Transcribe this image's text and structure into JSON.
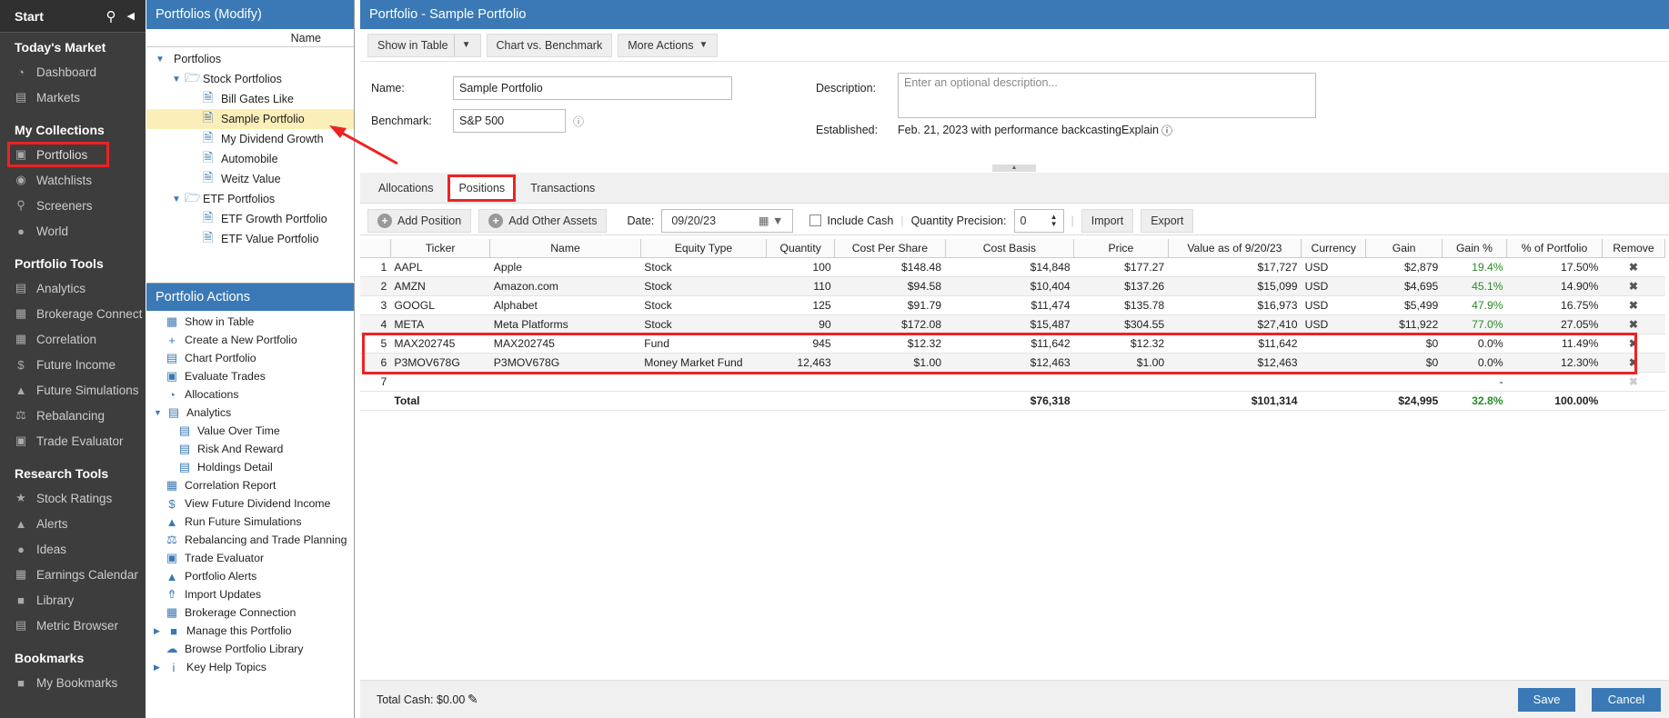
{
  "sidebar": {
    "start": "Start",
    "sections": [
      {
        "title": "Today's Market",
        "items": [
          {
            "label": "Dashboard",
            "icon": "dashboard-icon"
          },
          {
            "label": "Markets",
            "icon": "chart-icon"
          }
        ]
      },
      {
        "title": "My Collections",
        "items": [
          {
            "label": "Portfolios",
            "icon": "briefcase-icon"
          },
          {
            "label": "Watchlists",
            "icon": "binoculars-icon"
          },
          {
            "label": "Screeners",
            "icon": "search-icon"
          },
          {
            "label": "World",
            "icon": "globe-icon"
          }
        ]
      },
      {
        "title": "Portfolio Tools",
        "items": [
          {
            "label": "Analytics",
            "icon": "chart-icon"
          },
          {
            "label": "Brokerage Connect",
            "icon": "bank-icon"
          },
          {
            "label": "Correlation",
            "icon": "grid-icon"
          },
          {
            "label": "Future Income",
            "icon": "dollar-icon"
          },
          {
            "label": "Future Simulations",
            "icon": "flask-icon"
          },
          {
            "label": "Rebalancing",
            "icon": "scale-icon"
          },
          {
            "label": "Trade Evaluator",
            "icon": "briefcase-icon"
          }
        ]
      },
      {
        "title": "Research Tools",
        "items": [
          {
            "label": "Stock Ratings",
            "icon": "star-icon"
          },
          {
            "label": "Alerts",
            "icon": "bell-icon"
          },
          {
            "label": "Ideas",
            "icon": "bulb-icon"
          },
          {
            "label": "Earnings Calendar",
            "icon": "calendar-icon"
          },
          {
            "label": "Library",
            "icon": "book-icon"
          },
          {
            "label": "Metric Browser",
            "icon": "window-icon"
          }
        ]
      },
      {
        "title": "Bookmarks",
        "items": [
          {
            "label": "My Bookmarks",
            "icon": "bookmark-icon"
          }
        ]
      }
    ]
  },
  "tree": {
    "header": "Portfolios (Modify)",
    "column": "Name",
    "root": "Portfolios",
    "stock_folder": "Stock Portfolios",
    "stock_items": [
      "Bill Gates Like",
      "Sample Portfolio",
      "My Dividend Growth",
      "Automobile",
      "Weitz Value"
    ],
    "etf_folder": "ETF Portfolios",
    "etf_items": [
      "ETF Growth Portfolio",
      "ETF Value Portfolio"
    ]
  },
  "actions": {
    "header": "Portfolio Actions",
    "items": [
      "Show in Table",
      "Create a New Portfolio",
      "Chart Portfolio",
      "Evaluate Trades",
      "Allocations",
      "Analytics",
      "Value Over Time",
      "Risk And Reward",
      "Holdings Detail",
      "Correlation Report",
      "View Future Dividend Income",
      "Run Future Simulations",
      "Rebalancing and Trade Planning",
      "Trade Evaluator",
      "Portfolio Alerts",
      "Import Updates",
      "Brokerage Connection",
      "Manage this Portfolio",
      "Browse Portfolio Library",
      "Key Help Topics"
    ]
  },
  "main": {
    "title": "Portfolio - Sample Portfolio",
    "toolbar": {
      "show_table": "Show in Table",
      "chart_bench": "Chart vs. Benchmark",
      "more": "More Actions"
    },
    "form": {
      "name_label": "Name:",
      "name_value": "Sample Portfolio",
      "bench_label": "Benchmark:",
      "bench_value": "S&P 500",
      "desc_label": "Description:",
      "desc_placeholder": "Enter an optional description...",
      "est_label": "Established:",
      "est_value": "Feb. 21, 2023 with performance backcasting.",
      "explain": "Explain"
    },
    "tabs": [
      "Allocations",
      "Positions",
      "Transactions"
    ],
    "ptoolbar": {
      "add_position": "Add Position",
      "add_other": "Add Other Assets",
      "date_label": "Date:",
      "date_value": "09/20/23",
      "include_cash": "Include Cash",
      "qp_label": "Quantity Precision:",
      "qp_value": "0",
      "import": "Import",
      "export": "Export"
    },
    "columns": [
      "",
      "Ticker",
      "Name",
      "Equity Type",
      "Quantity",
      "Cost Per Share",
      "Cost Basis",
      "Price",
      "Value as of 9/20/23",
      "Currency",
      "Gain",
      "Gain %",
      "% of Portfolio",
      "Remove"
    ],
    "rows": [
      [
        "1",
        "AAPL",
        "Apple",
        "Stock",
        "100",
        "$148.48",
        "$14,848",
        "$177.27",
        "$17,727",
        "USD",
        "$2,879",
        "19.4%",
        "17.50%"
      ],
      [
        "2",
        "AMZN",
        "Amazon.com",
        "Stock",
        "110",
        "$94.58",
        "$10,404",
        "$137.26",
        "$15,099",
        "USD",
        "$4,695",
        "45.1%",
        "14.90%"
      ],
      [
        "3",
        "GOOGL",
        "Alphabet",
        "Stock",
        "125",
        "$91.79",
        "$11,474",
        "$135.78",
        "$16,973",
        "USD",
        "$5,499",
        "47.9%",
        "16.75%"
      ],
      [
        "4",
        "META",
        "Meta Platforms",
        "Stock",
        "90",
        "$172.08",
        "$15,487",
        "$304.55",
        "$27,410",
        "USD",
        "$11,922",
        "77.0%",
        "27.05%"
      ],
      [
        "5",
        "MAX202745",
        "MAX202745",
        "Fund",
        "945",
        "$12.32",
        "$11,642",
        "$12.32",
        "$11,642",
        "",
        "$0",
        "0.0%",
        "11.49%"
      ],
      [
        "6",
        "P3MOV678G",
        "P3MOV678G",
        "Money Market Fund",
        "12,463",
        "$1.00",
        "$12,463",
        "$1.00",
        "$12,463",
        "",
        "$0",
        "0.0%",
        "12.30%"
      ]
    ],
    "empty_row": {
      "num": "7",
      "dash": "-"
    },
    "total": {
      "label": "Total",
      "cost_basis": "$76,318",
      "value": "$101,314",
      "gain": "$24,995",
      "gain_pct": "32.8%",
      "pct": "100.00%"
    },
    "footer": {
      "cash": "Total Cash: $0.00",
      "save": "Save",
      "cancel": "Cancel"
    }
  },
  "colors": {
    "accent": "#3a79b5",
    "highlight": "#e22222",
    "gain": "#2a8a2a"
  }
}
